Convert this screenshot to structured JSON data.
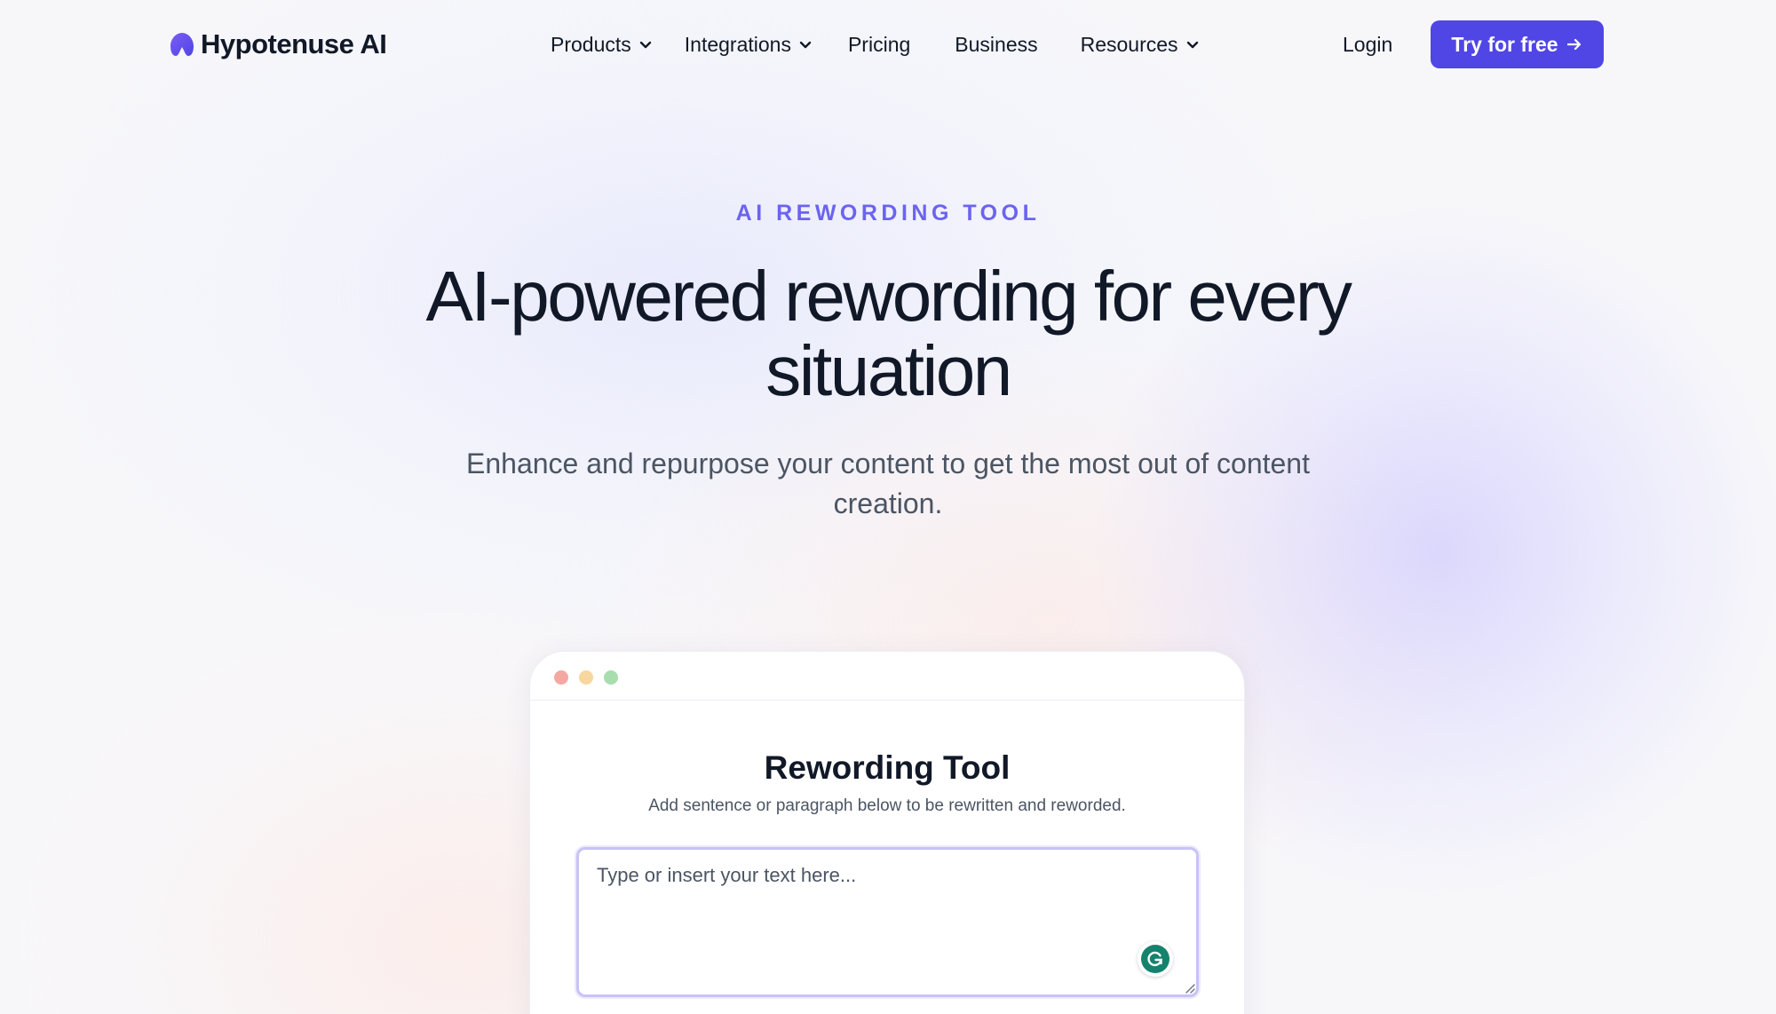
{
  "nav": {
    "brand": "Hypotenuse AI",
    "items": [
      {
        "label": "Products",
        "dropdown": true
      },
      {
        "label": "Integrations",
        "dropdown": true
      },
      {
        "label": "Pricing",
        "dropdown": false
      },
      {
        "label": "Business",
        "dropdown": false
      },
      {
        "label": "Resources",
        "dropdown": true
      }
    ],
    "login_label": "Login",
    "cta_label": "Try for free"
  },
  "hero": {
    "eyebrow": "AI REWORDING TOOL",
    "headline": "AI-powered rewording for every situation",
    "subheadline": "Enhance and repurpose your content to get the most out of content creation."
  },
  "tool": {
    "title": "Rewording Tool",
    "subtitle": "Add sentence or paragraph below to be rewritten and reworded.",
    "input_placeholder": "Type or insert your text here...",
    "input_value": ""
  },
  "icons": {
    "logo": "hypotenuse-logo-icon",
    "dropdown": "chevron-down-icon",
    "cta": "arrow-right-icon",
    "extension": "grammarly-icon"
  },
  "colors": {
    "accent": "#5046e5",
    "eyebrow": "#6c63f0",
    "text": "#111827",
    "muted": "#4b5563",
    "window_red": "#f4a8a2",
    "window_yellow": "#f7d79f",
    "window_green": "#a8ddae",
    "grammarly": "#15826d"
  }
}
